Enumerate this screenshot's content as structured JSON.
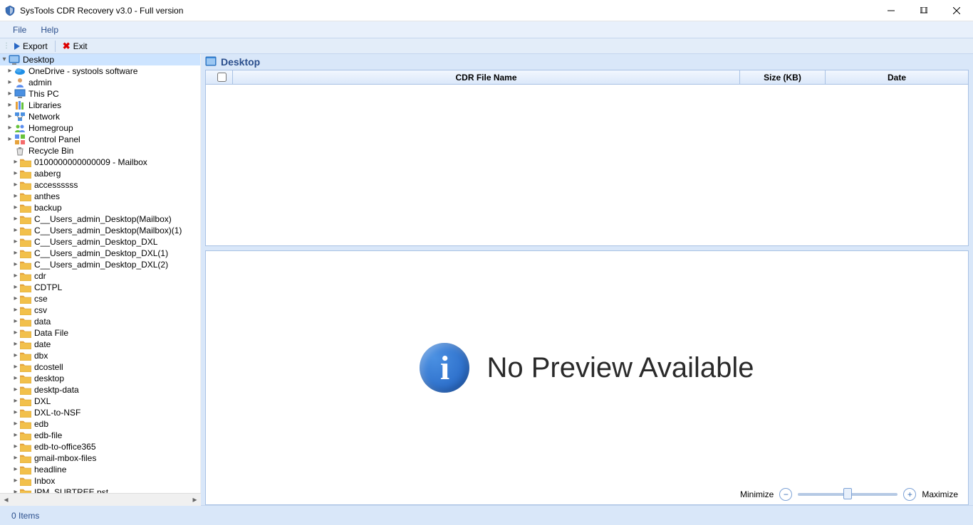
{
  "window": {
    "title": "SysTools CDR Recovery v3.0 - Full version"
  },
  "menu": {
    "file": "File",
    "help": "Help"
  },
  "toolbar": {
    "export": "Export",
    "exit": "Exit"
  },
  "tree": {
    "root": {
      "label": "Desktop",
      "icon": "desktop",
      "expanded": true
    },
    "top_items": [
      {
        "label": "OneDrive - systools software",
        "icon": "onedrive"
      },
      {
        "label": "admin",
        "icon": "user"
      },
      {
        "label": "This PC",
        "icon": "pc"
      },
      {
        "label": "Libraries",
        "icon": "libraries"
      },
      {
        "label": "Network",
        "icon": "network"
      },
      {
        "label": "Homegroup",
        "icon": "homegroup"
      },
      {
        "label": "Control Panel",
        "icon": "control"
      },
      {
        "label": "Recycle Bin",
        "icon": "recycle"
      }
    ],
    "folders": [
      "0100000000000009 - Mailbox",
      "aaberg",
      "accessssss",
      "anthes",
      "backup",
      "C__Users_admin_Desktop(Mailbox)",
      "C__Users_admin_Desktop(Mailbox)(1)",
      "C__Users_admin_Desktop_DXL",
      "C__Users_admin_Desktop_DXL(1)",
      "C__Users_admin_Desktop_DXL(2)",
      "cdr",
      "CDTPL",
      "cse",
      "csv",
      "data",
      "Data File",
      "date",
      "dbx",
      "dcostell",
      "desktop",
      "desktp-data",
      "DXL",
      "DXL-to-NSF",
      "edb",
      "edb-file",
      "edb-to-office365",
      "gmail-mbox-files",
      "headline",
      "Inbox",
      "IPM_SUBTREE.pst"
    ]
  },
  "breadcrumb": {
    "label": "Desktop"
  },
  "list": {
    "columns": {
      "name": "CDR File Name",
      "size": "Size (KB)",
      "date": "Date"
    }
  },
  "preview": {
    "message": "No Preview Available"
  },
  "zoom": {
    "min_label": "Minimize",
    "max_label": "Maximize"
  },
  "status": {
    "text": "0 Items"
  }
}
